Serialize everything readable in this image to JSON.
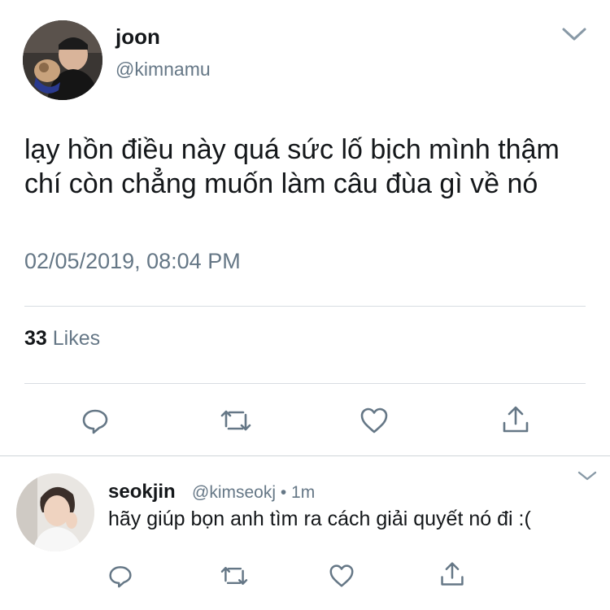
{
  "main_tweet": {
    "display_name": "joon",
    "handle": "@kimnamu",
    "text": "lạy hồn điều này quá sức lố bịch mình thậm chí còn chẳng muốn làm câu đùa gì về nó",
    "timestamp": "02/05/2019, 08:04 PM",
    "likes_count": "33",
    "likes_label": "Likes",
    "menu_icon": "chevron-down-icon",
    "actions": [
      "reply-icon",
      "retweet-icon",
      "like-icon",
      "share-icon"
    ]
  },
  "reply": {
    "display_name": "seokjin",
    "handle_meta": "@kimseokj • 1m",
    "text": "hãy giúp bọn anh tìm ra cách giải quyết nó đi :(",
    "menu_icon": "chevron-down-icon",
    "actions": [
      "reply-icon",
      "retweet-icon",
      "like-icon",
      "share-icon"
    ]
  },
  "colors": {
    "text": "#14171a",
    "secondary": "#657786",
    "icon": "#657786",
    "divider": "#d8dde2"
  }
}
